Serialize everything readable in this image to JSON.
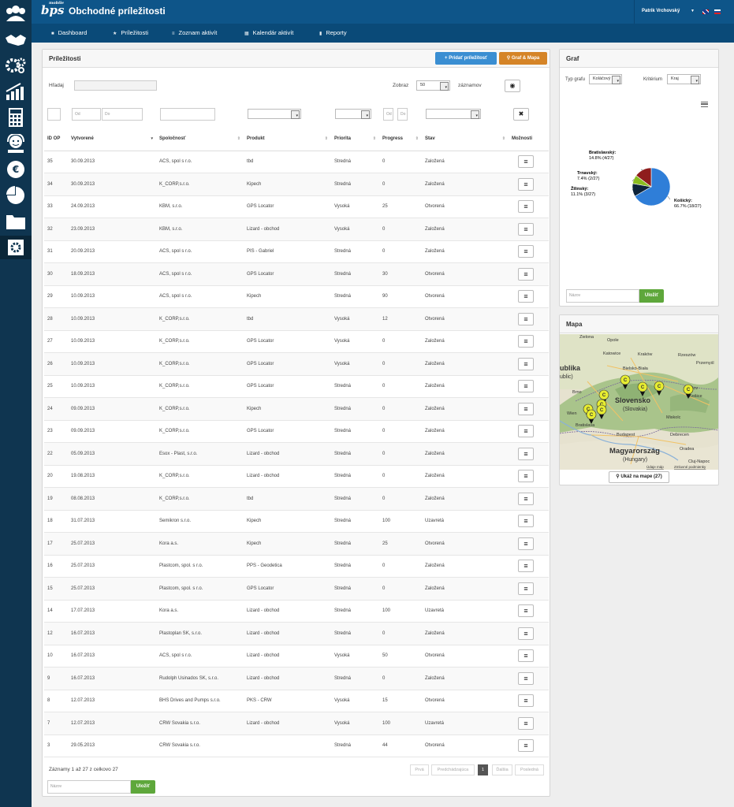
{
  "app": {
    "title": "Obchodné príležitosti",
    "logo": "bps",
    "logo_sub": "mobile",
    "user": "Patrik Vrchovský"
  },
  "colors": {
    "topbar": "#0e5589",
    "sidebar": "#0f3550",
    "add_button": "#3a8ed2",
    "graph_button": "#d58427",
    "save_button": "#5ea73b"
  },
  "sidebar_icons": [
    "clients-icon",
    "handshake-icon",
    "gears-icon",
    "chart-growth-icon",
    "calculator-icon",
    "support-icon",
    "money-icon",
    "pie-chart-icon",
    "folders-icon",
    "settings-icon"
  ],
  "nav": {
    "items": [
      {
        "icon": "■",
        "label": "Dashboard"
      },
      {
        "icon": "★",
        "label": "Príležitosti"
      },
      {
        "icon": "≡",
        "label": "Zoznam aktivít"
      },
      {
        "icon": "▦",
        "label": "Kalendár aktivít"
      },
      {
        "icon": "▮",
        "label": "Reporty"
      }
    ]
  },
  "main": {
    "title": "Príležitosti",
    "add_btn": "Pridať príležitosť",
    "graph_btn": "Graf & Mapa",
    "search_label": "Hľadaj",
    "show_label": "Zobraz",
    "show_value": "50",
    "show_suffix": "záznamov",
    "from_ph": "Od",
    "to_ph": "Do",
    "columns": [
      "ID OP",
      "Vytvorené",
      "Spoločnosť",
      "Produkt",
      "Priorita",
      "Progress",
      "Stav",
      "Možnosti"
    ],
    "rows": [
      [
        "35",
        "30.09.2013",
        "ACS, spol s r.o.",
        "tbd",
        "Stredná",
        "0",
        "Založená"
      ],
      [
        "34",
        "30.09.2013",
        "K_CORP,s.r.o.",
        "Kipech",
        "Stredná",
        "0",
        "Založená"
      ],
      [
        "33",
        "24.09.2013",
        "KBM, s.r.o.",
        "GPS Locator",
        "Vysoká",
        "25",
        "Otvorená"
      ],
      [
        "32",
        "23.09.2013",
        "KBM, s.r.o.",
        "Lizard - obchod",
        "Vysoká",
        "0",
        "Založená"
      ],
      [
        "31",
        "20.09.2013",
        "ACS, spol s r.o.",
        "PIS - Gabriel",
        "Stredná",
        "0",
        "Založená"
      ],
      [
        "30",
        "18.09.2013",
        "ACS, spol s r.o.",
        "GPS Locator",
        "Stredná",
        "30",
        "Otvorená"
      ],
      [
        "29",
        "10.09.2013",
        "ACS, spol s r.o.",
        "Kipech",
        "Stredná",
        "90",
        "Otvorená"
      ],
      [
        "28",
        "10.09.2013",
        "K_CORP,s.r.o.",
        "tbd",
        "Vysoká",
        "12",
        "Otvorená"
      ],
      [
        "27",
        "10.09.2013",
        "K_CORP,s.r.o.",
        "GPS Locator",
        "Vysoká",
        "0",
        "Založená"
      ],
      [
        "26",
        "10.09.2013",
        "K_CORP,s.r.o.",
        "GPS Locator",
        "Vysoká",
        "0",
        "Založená"
      ],
      [
        "25",
        "10.09.2013",
        "K_CORP,s.r.o.",
        "GPS Locator",
        "Stredná",
        "0",
        "Založená"
      ],
      [
        "24",
        "09.09.2013",
        "K_CORP,s.r.o.",
        "Kipech",
        "Stredná",
        "0",
        "Založená"
      ],
      [
        "23",
        "09.09.2013",
        "K_CORP,s.r.o.",
        "GPS Locator",
        "Stredná",
        "0",
        "Založená"
      ],
      [
        "22",
        "05.09.2013",
        "Esox - Plast, s.r.o.",
        "Lizard - obchod",
        "Stredná",
        "0",
        "Založená"
      ],
      [
        "20",
        "19.08.2013",
        "K_CORP,s.r.o.",
        "Lizard - obchod",
        "Stredná",
        "0",
        "Založená"
      ],
      [
        "19",
        "08.08.2013",
        "K_CORP,s.r.o.",
        "tbd",
        "Stredná",
        "0",
        "Založená"
      ],
      [
        "18",
        "31.07.2013",
        "Semikron s.r.o.",
        "Kipech",
        "Stredná",
        "100",
        "Uzavretá"
      ],
      [
        "17",
        "25.07.2013",
        "Kora a.s.",
        "Kipech",
        "Stredná",
        "25",
        "Otvorená"
      ],
      [
        "16",
        "25.07.2013",
        "Plastcom, spol. s r.o.",
        "PPS - Geodetica",
        "Stredná",
        "0",
        "Založená"
      ],
      [
        "15",
        "25.07.2013",
        "Plastcom, spol. s r.o.",
        "GPS Locator",
        "Stredná",
        "0",
        "Založená"
      ],
      [
        "14",
        "17.07.2013",
        "Kora a.s.",
        "Lizard - obchod",
        "Stredná",
        "100",
        "Uzavretá"
      ],
      [
        "12",
        "16.07.2013",
        "Plastoplan SK, s.r.o.",
        "Lizard - obchod",
        "Stredná",
        "0",
        "Založená"
      ],
      [
        "10",
        "16.07.2013",
        "ACS, spol s r.o.",
        "Lizard - obchod",
        "Vysoká",
        "50",
        "Otvorená"
      ],
      [
        "9",
        "16.07.2013",
        "Rudolph Usinados SK, s.r.o.",
        "Lizard - obchod",
        "Stredná",
        "0",
        "Založená"
      ],
      [
        "8",
        "12.07.2013",
        "BHS Drives and Pumps s.r.o.",
        "PKS - CRW",
        "Vysoká",
        "15",
        "Otvorená"
      ],
      [
        "7",
        "12.07.2013",
        "CRW Sovakia s.r.o.",
        "Lizard - obchod",
        "Vysoká",
        "100",
        "Uzavretá"
      ],
      [
        "3",
        "29.05.2013",
        "CRW Sovakia s.r.o.",
        "",
        "Stredná",
        "44",
        "Otvorená"
      ]
    ],
    "footer_info": "Záznamy 1 až 27 z celkovo 27",
    "pager": [
      "Prvá",
      "Predchádzajúca",
      "1",
      "Ďalšia",
      "Posledná"
    ],
    "name_ph": "Názov",
    "save": "Uložiť"
  },
  "graph": {
    "title": "Graf",
    "type_label": "Typ grafu",
    "type_value": "Koláčový",
    "crit_label": "Kritérium",
    "crit_value": "Kraj",
    "name_ph": "Názov",
    "save": "Uložiť"
  },
  "chart_data": {
    "type": "pie",
    "title": "",
    "categories": [
      "Košický",
      "Bratislavský",
      "Trnavský",
      "Žilinský"
    ],
    "values": [
      18,
      4,
      2,
      3
    ],
    "labels": [
      "66.7% (18/27)",
      "14.8% (4/27)",
      "7.4% (2/27)",
      "11.1% (3/27)"
    ],
    "colors": [
      "#2f7ed8",
      "#8f1d1d",
      "#8bbc21",
      "#0d233a"
    ]
  },
  "map": {
    "title": "Mapa",
    "show_btn": "Ukáž na mape (27)",
    "labels": {
      "zielona": "Zielona",
      "opole": "Opole",
      "katowice": "Katowice",
      "krakow": "Kraków",
      "rzeszow": "Rzeszów",
      "przemysl": "Przemyśl",
      "bielsko": "Bielsko-Biała",
      "republika": "ublika",
      "republic": "ublic)",
      "brno": "Brno",
      "slovensko": "Slovensko",
      "slovakia": "(Slovakia)",
      "presov": "Prešov",
      "kosice": "Košice",
      "miskolc": "Miskolc",
      "wien": "Wien",
      "bratislava": "Bratislava",
      "budapest": "Budapest",
      "debrecen": "Debrecen",
      "hungary_hu": "Magyarország",
      "hungary_en": "(Hungary)",
      "oradea": "Oradea",
      "cluj": "Cluj-Napoc"
    },
    "attribution": "Údaje máp",
    "terms": "Zmluvné podmienky"
  }
}
